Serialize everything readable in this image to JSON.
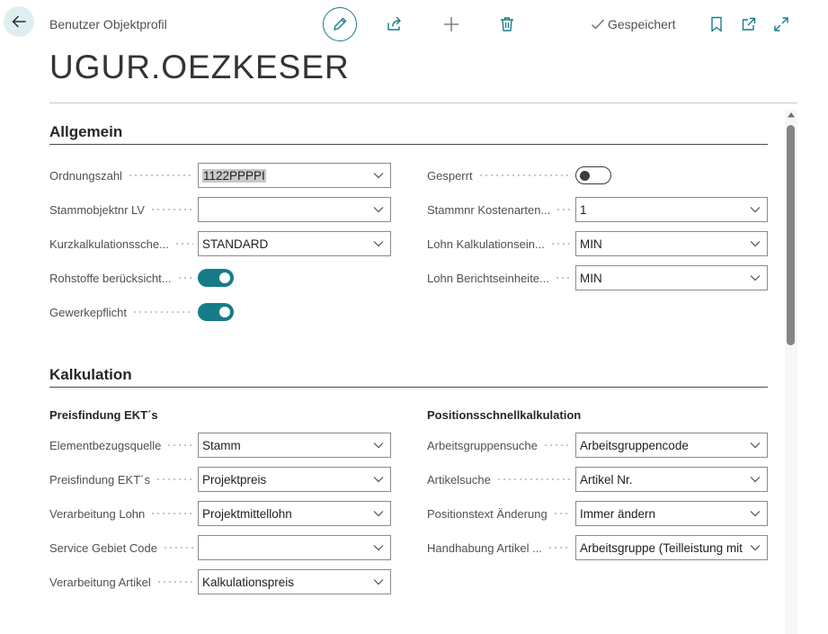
{
  "header": {
    "breadcrumb": "Benutzer Objektprofil",
    "status": "Gespeichert",
    "icons": [
      "back-arrow-icon",
      "pencil-icon",
      "share-icon",
      "plus-icon",
      "trash-icon",
      "check-icon",
      "bookmark-icon",
      "open-new-window-icon",
      "expand-icon"
    ]
  },
  "title": "UGUR.OEZKESER",
  "allgemein": {
    "heading": "Allgemein",
    "left": [
      {
        "label": "Ordnungszahl",
        "type": "select",
        "value": "1122PPPPI"
      },
      {
        "label": "Stammobjektnr LV",
        "type": "select",
        "value": ""
      },
      {
        "label": "Kurzkalkulationssche...",
        "type": "select",
        "value": "STANDARD"
      },
      {
        "label": "Rohstoffe berücksicht...",
        "type": "toggle",
        "on": true
      },
      {
        "label": "Gewerkepflicht",
        "type": "toggle",
        "on": true
      }
    ],
    "right": [
      {
        "label": "Gesperrt",
        "type": "toggle",
        "on": false
      },
      {
        "label": "Stammnr Kostenarten...",
        "type": "select",
        "value": "1"
      },
      {
        "label": "Lohn Kalkulationsein...",
        "type": "select",
        "value": "MIN"
      },
      {
        "label": "Lohn Berichtseinheite...",
        "type": "select",
        "value": "MIN"
      }
    ]
  },
  "kalkulation": {
    "heading": "Kalkulation",
    "left_group": "Preisfindung EKT´s",
    "right_group": "Positionsschnellkalkulation",
    "left": [
      {
        "label": "Elementbezugsquelle",
        "value": "Stamm"
      },
      {
        "label": "Preisfindung EKT´s",
        "value": "Projektpreis"
      },
      {
        "label": "Verarbeitung Lohn",
        "value": "Projektmittellohn"
      },
      {
        "label": "Service Gebiet Code",
        "value": ""
      },
      {
        "label": "Verarbeitung Artikel",
        "value": "Kalkulationspreis"
      }
    ],
    "right": [
      {
        "label": "Arbeitsgruppensuche",
        "value": "Arbeitsgruppencode"
      },
      {
        "label": "Artikelsuche",
        "value": "Artikel Nr."
      },
      {
        "label": "Positionstext Änderung",
        "value": "Immer ändern"
      },
      {
        "label": "Handhabung Artikel ...",
        "value": "Arbeitsgruppe (Teilleistung mit"
      }
    ]
  },
  "colors": {
    "accent": "#167c88",
    "back_button_bg": "#dfeff1"
  }
}
